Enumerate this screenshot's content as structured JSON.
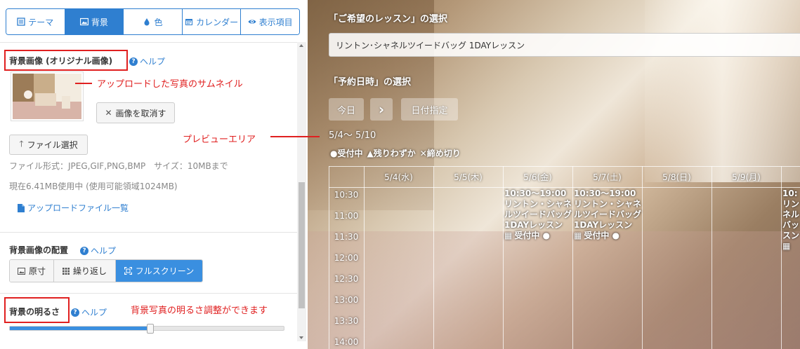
{
  "tabs": [
    {
      "label": "テーマ",
      "icon": "list-icon"
    },
    {
      "label": "背景",
      "icon": "image-icon"
    },
    {
      "label": "色",
      "icon": "droplet-icon"
    },
    {
      "label": "カレンダー",
      "icon": "calendar-icon"
    },
    {
      "label": "表示項目",
      "icon": "eye-icon"
    }
  ],
  "bg_image": {
    "title": "背景画像 (オリジナル画像)",
    "help": "ヘルプ",
    "cancel_label": "画像を取消す",
    "file_select_label": "ファイル選択",
    "formats": "ファイル形式：JPEG,GIF,PNG,BMP　サイズ：10MBまで",
    "usage": "現在6.41MB使用中 (使用可能領域1024MB)",
    "upload_list_label": "アップロードファイル一覧"
  },
  "layout": {
    "title": "背景画像の配置",
    "help": "ヘルプ",
    "options": [
      "原寸",
      "繰り返し",
      "フルスクリーン"
    ],
    "selected": "フルスクリーン"
  },
  "brightness": {
    "title": "背景の明るさ",
    "help": "ヘルプ",
    "value_fraction": 0.51
  },
  "annotations": {
    "thumbnail": "アップロードした写真のサムネイル",
    "preview": "プレビューエリア",
    "brightness": "背景写真の明るさ調整ができます"
  },
  "preview": {
    "lesson_heading": "「ご希望のレッスン」の選択",
    "lesson_value": "リントン･シャネルツイードバッグ 1DAYレッスン",
    "date_heading": "「予約日時」の選択",
    "today_label": "今日",
    "next_label": "›",
    "date_pick_label": "日付指定",
    "range": "5/4～ 5/10",
    "legend": {
      "open": "●受付中",
      "few": "▲残りわずか",
      "closed": "✕締め切り"
    },
    "days": [
      "5/4(水)",
      "5/5(木)",
      "5/6(金)",
      "5/7(土)",
      "5/8(日)",
      "5/9(月)"
    ],
    "times": [
      "10:30",
      "11:00",
      "11:30",
      "12:00",
      "12:30",
      "13:00",
      "13:30",
      "14:00"
    ],
    "events": [
      {
        "time": "10:30～19:00",
        "name": "リントン・シャネルツイードバッグ 1DAYレッスン",
        "status": "受付中 ●"
      },
      {
        "time": "10:30～19:00",
        "name": "リントン・シャネルツイードバッグ 1DAYレッスン",
        "status": "受付中 ●"
      },
      {
        "time": "10:",
        "name": "リン ネル バッ スン",
        "status": "▦"
      }
    ]
  }
}
